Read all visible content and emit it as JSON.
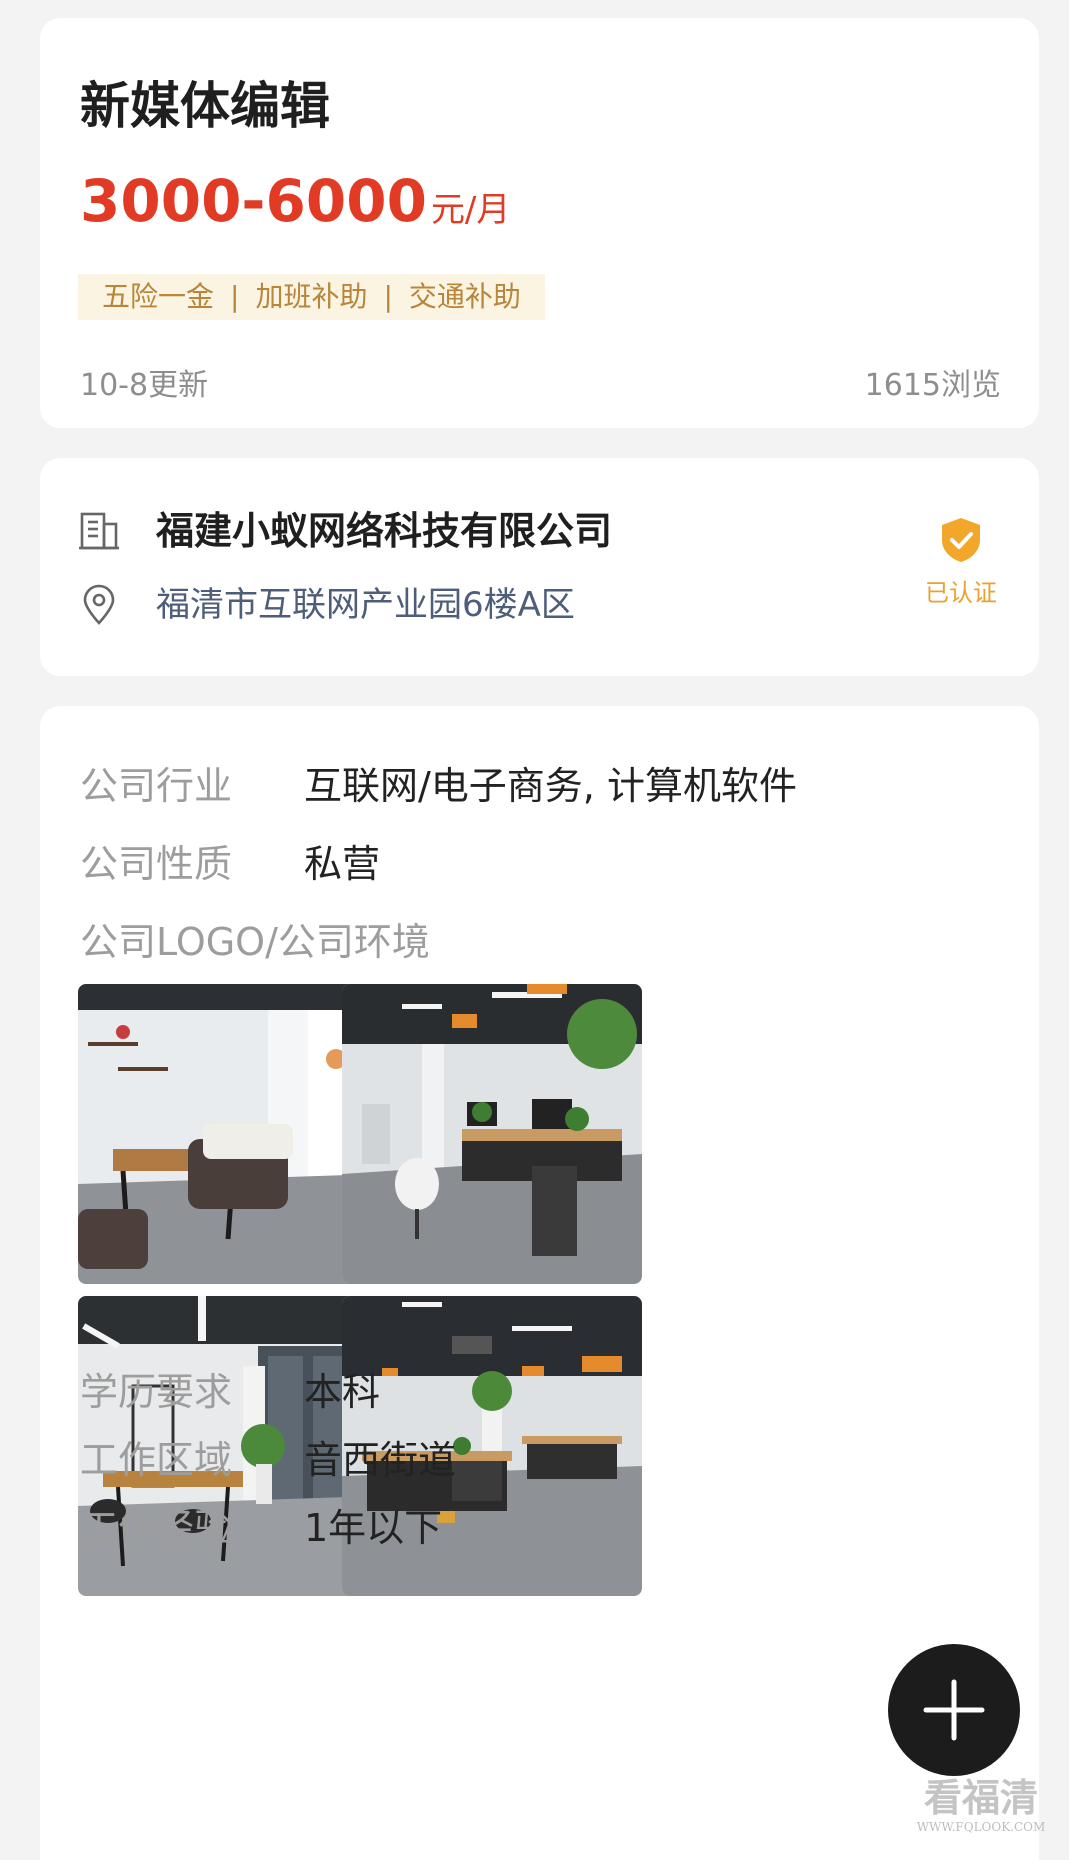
{
  "job": {
    "title": "新媒体编辑",
    "salary": "3000-6000",
    "salary_unit": "元/月",
    "benefits": [
      "五险一金",
      "加班补助",
      "交通补助"
    ],
    "benefit_separator": "|",
    "updated": "10-8更新",
    "views": "1615浏览"
  },
  "company": {
    "name": "福建小蚁网络科技有限公司",
    "address": "福清市互联网产业园6楼A区",
    "verified_label": "已认证",
    "icons": {
      "building": "building-icon",
      "location": "location-pin-icon",
      "verified": "shield-check-icon"
    }
  },
  "details": {
    "industry_label": "公司行业",
    "industry_value": "互联网/电子商务, 计算机软件",
    "nature_label": "公司性质",
    "nature_value": "私营",
    "photos_label": "公司LOGO/公司环境",
    "photos": [
      "office-lounge-photo",
      "office-workstations-photo",
      "office-dining-area-photo",
      "office-open-floor-photo"
    ],
    "education_label": "学历要求",
    "education_value": "本科",
    "area_label": "工作区域",
    "area_value": "音西街道",
    "experience_label": "工作经验",
    "experience_value": "1年以下"
  },
  "fab": {
    "icon": "plus-icon"
  },
  "watermark": {
    "main": "看福清",
    "sub": "WWW.FQLOOK.COM"
  },
  "colors": {
    "salary": "#e23b25",
    "benefit_text": "#b8863a",
    "benefit_bg": "#fbf4e3",
    "verified": "#e9a22a",
    "address": "#4d5d7a"
  }
}
